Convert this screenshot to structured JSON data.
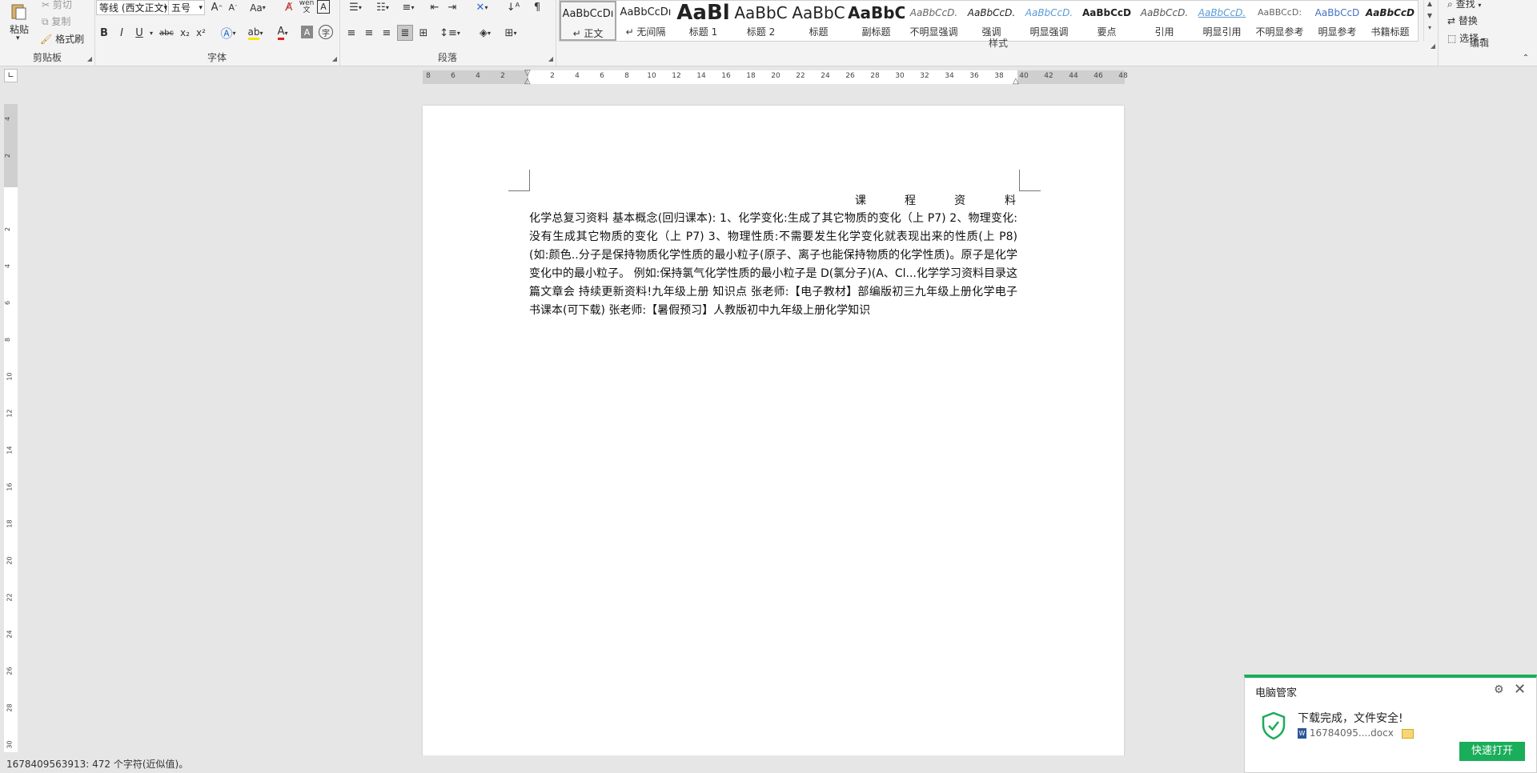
{
  "ribbon": {
    "clipboard": {
      "paste": "粘贴",
      "cut": "剪切",
      "copy": "复制",
      "format_painter": "格式刷",
      "label": "剪贴板"
    },
    "font": {
      "font_name": "等线 (西文正文)",
      "font_size": "五号",
      "label": "字体",
      "grow": "A",
      "shrink": "A",
      "case": "Aa",
      "bold": "B",
      "italic": "I",
      "underline": "U",
      "strike": "abc",
      "sub": "x₂",
      "sup": "x²",
      "color_letter": "A",
      "phonetic_top": "wén",
      "phonetic_bottom": "文"
    },
    "paragraph": {
      "label": "段落"
    },
    "styles": {
      "label": "样式",
      "items": [
        {
          "preview": "AaBbCcDı",
          "name": "↵ 正文"
        },
        {
          "preview": "AaBbCcDı",
          "name": "↵ 无间隔"
        },
        {
          "preview": "AaBl",
          "name": "标题 1"
        },
        {
          "preview": "AaBbC",
          "name": "标题 2"
        },
        {
          "preview": "AaBbC",
          "name": "标题"
        },
        {
          "preview": "AaBbC",
          "name": "副标题"
        },
        {
          "preview": "AaBbCcD.",
          "name": "不明显强调"
        },
        {
          "preview": "AaBbCcD.",
          "name": "强调"
        },
        {
          "preview": "AaBbCcD.",
          "name": "明显强调"
        },
        {
          "preview": "AaBbCcD",
          "name": "要点"
        },
        {
          "preview": "AaBbCcD.",
          "name": "引用"
        },
        {
          "preview": "AaBbCcD.",
          "name": "明显引用"
        },
        {
          "preview": "AaBBCcD:",
          "name": "不明显参考"
        },
        {
          "preview": "AaBbCcD",
          "name": "明显参考"
        },
        {
          "preview": "AaBbCcD",
          "name": "书籍标题"
        }
      ]
    },
    "editing": {
      "label": "编辑",
      "find": "查找",
      "replace": "替换",
      "select": "选择"
    }
  },
  "ruler": {
    "h_numbers": [
      "8",
      "6",
      "4",
      "2",
      "",
      "2",
      "4",
      "6",
      "8",
      "10",
      "12",
      "14",
      "16",
      "18",
      "20",
      "22",
      "24",
      "26",
      "28",
      "30",
      "32",
      "34",
      "36",
      "38",
      "40",
      "42",
      "44",
      "46",
      "48"
    ],
    "v_numbers": [
      "4",
      "2",
      "",
      "2",
      "4",
      "6",
      "8",
      "10",
      "12",
      "14",
      "16",
      "18",
      "20",
      "22",
      "24",
      "26",
      "28",
      "30"
    ]
  },
  "document": {
    "title_chars": [
      "课",
      "程",
      "资",
      "料"
    ],
    "body": "化学总复习资料 基本概念(回归课本): 1、化学变化:生成了其它物质的变化（上 P7) 2、物理变化:没有生成其它物质的变化（上 P7) 3、物理性质:不需要发生化学变化就表现出来的性质(上 P8) (如:颜色..分子是保持物质化学性质的最小粒子(原子、离子也能保持物质的化学性质)。原子是化学变化中的最小粒子。 例如:保持氯气化学性质的最小粒子是 D(氯分子)(A、Cl...化学学习资料目录这篇文章会 持续更新资料!九年级上册 知识点 张老师:【电子教材】部编版初三九年级上册化学电子书课本(可下载) 张老师:【暑假预习】人教版初中九年级上册化学知识"
  },
  "status": {
    "text": "1678409563913: 472 个字符(近似值)。"
  },
  "toast": {
    "app": "电脑管家",
    "message": "下载完成，文件安全!",
    "file": "16784095....docx",
    "open_button": "快速打开",
    "accent": "#1aad5a"
  }
}
